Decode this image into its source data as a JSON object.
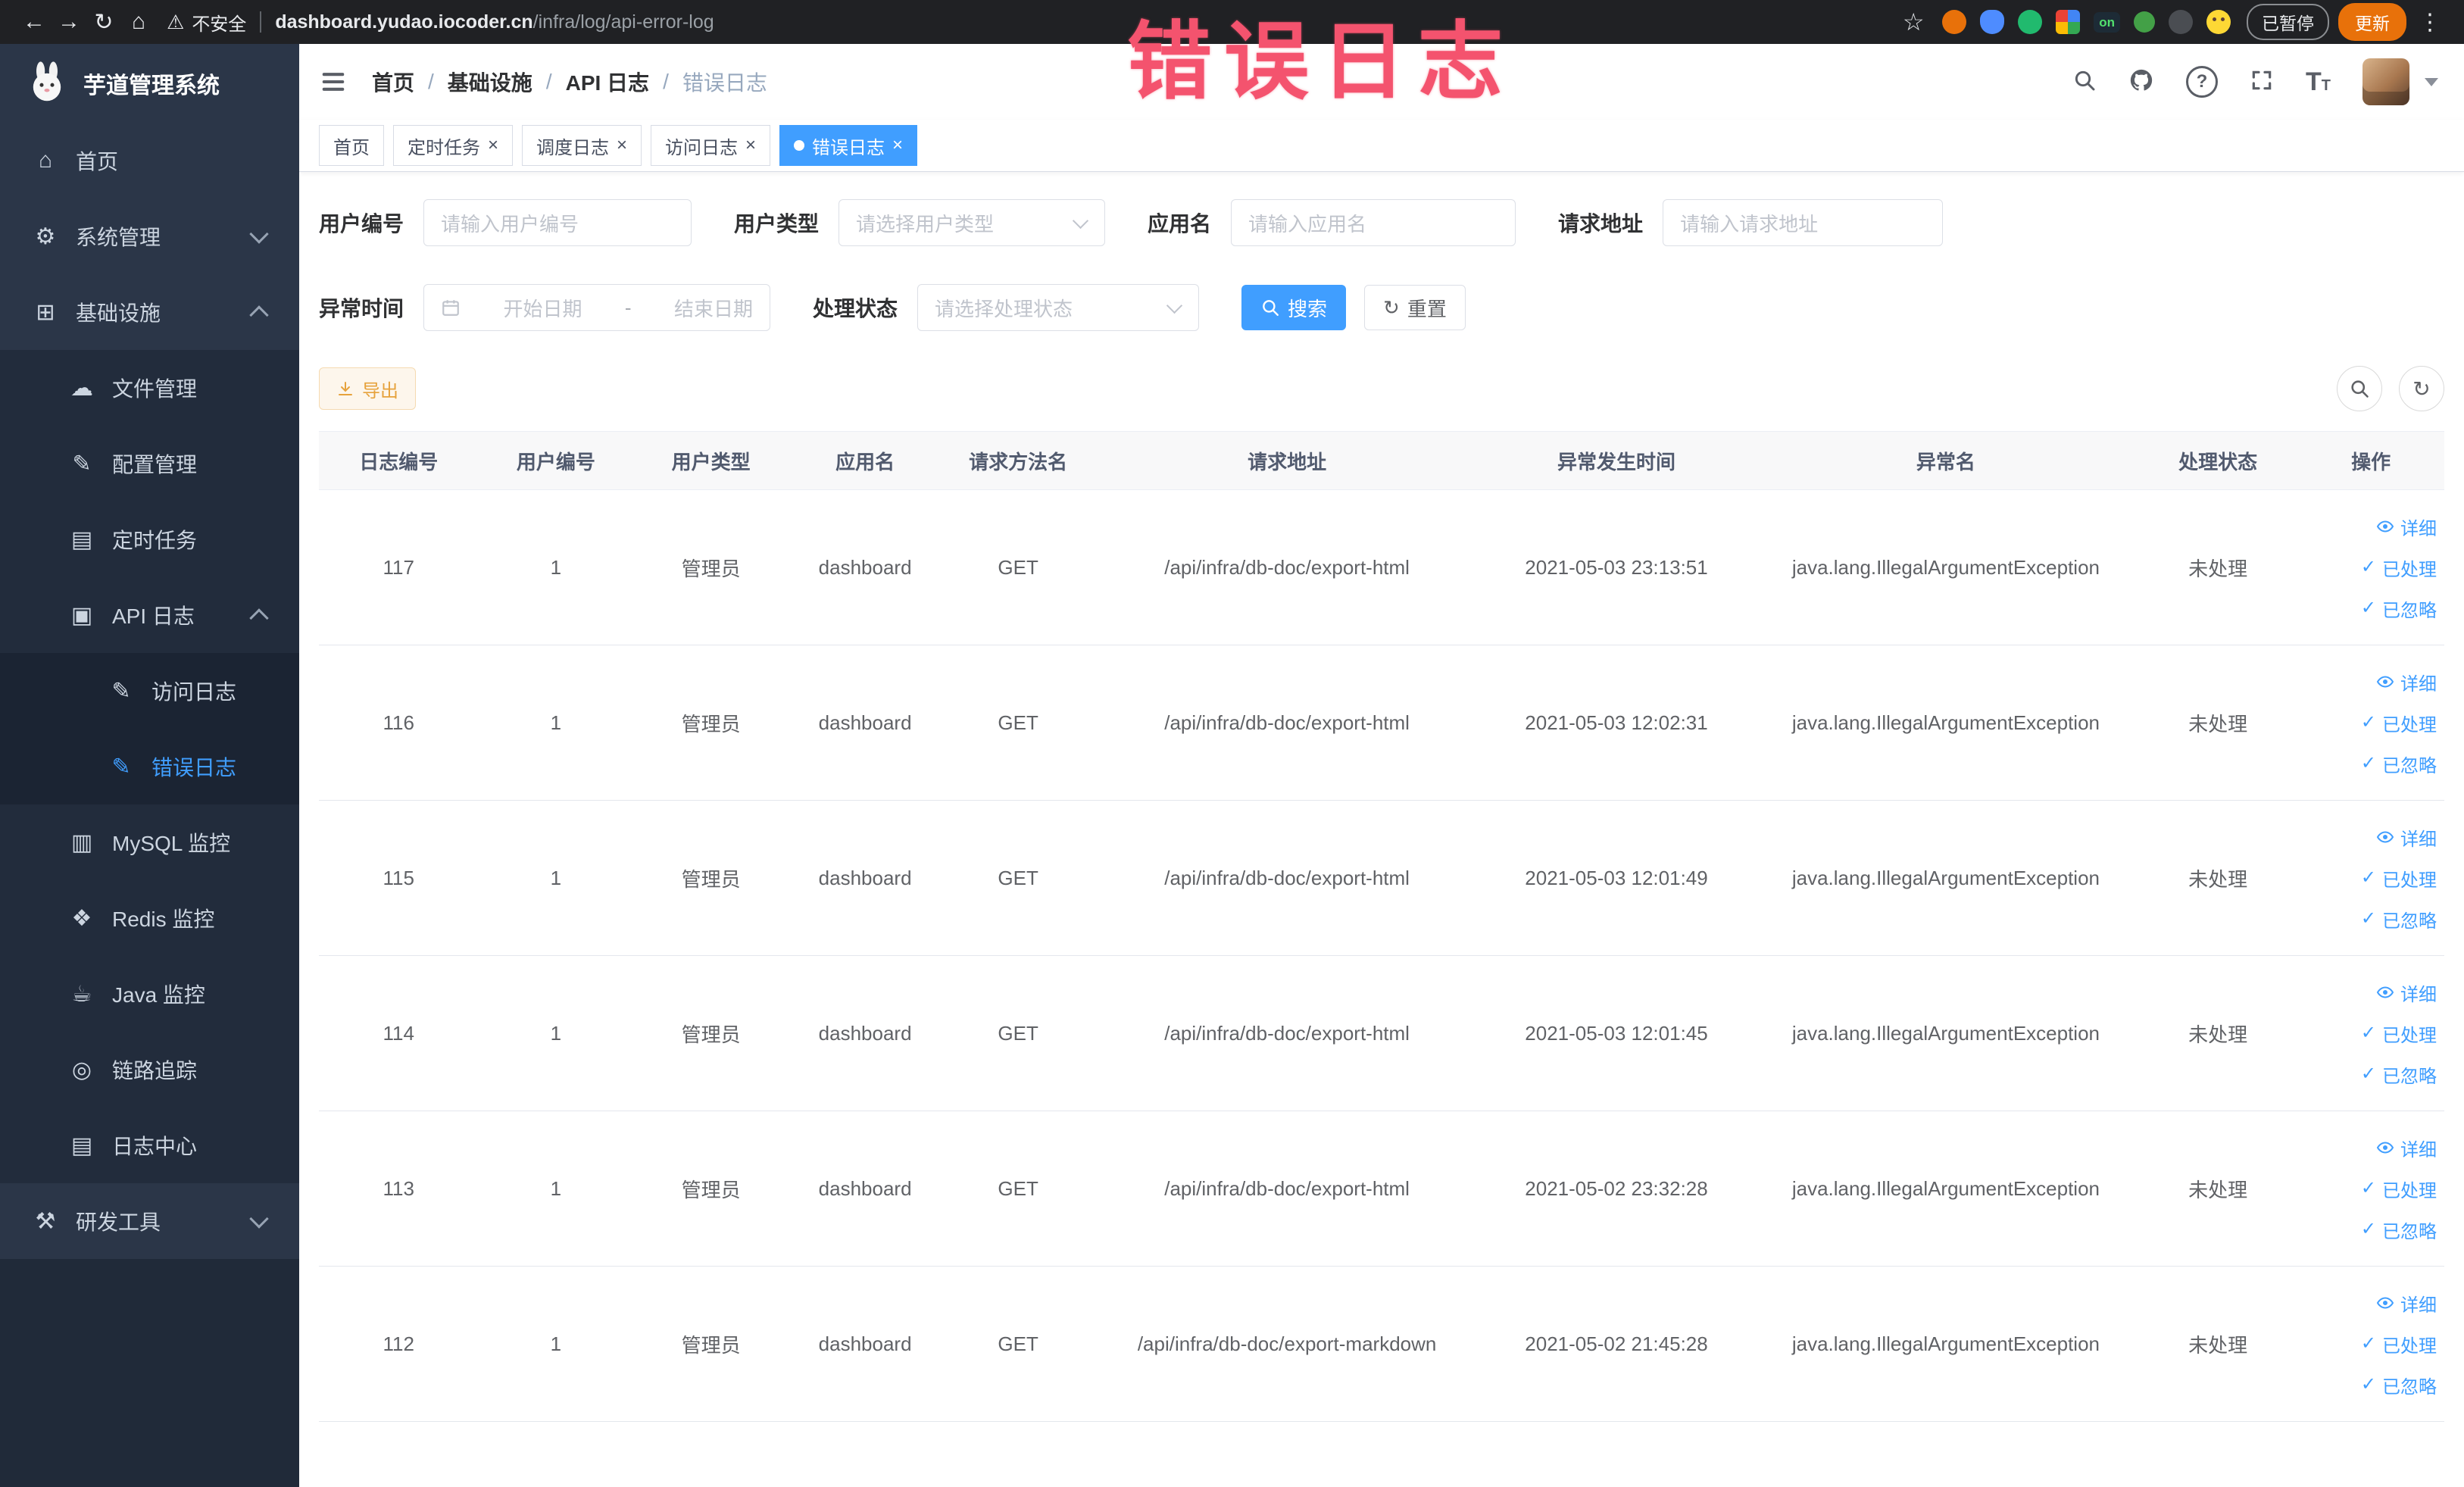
{
  "browser": {
    "security_label": "不安全",
    "url_host": "dashboard.yudao.iocoder.cn",
    "url_path": "/infra/log/api-error-log",
    "ext_on_label": "on",
    "paused_label": "已暂停",
    "update_label": "更新"
  },
  "annotation": {
    "text": "错误日志",
    "color": "#f4536e"
  },
  "icons": {
    "back": "←",
    "forward": "→",
    "reload": "↻",
    "home": "⌂",
    "warning": "⚠",
    "star": "☆",
    "menu_dots": "⋮",
    "close": "×",
    "check": "✓",
    "refresh": "↻",
    "help": "?",
    "font_size": "T",
    "menu_home": "⌂",
    "menu_system": "⚙",
    "menu_infra": "⊞",
    "menu_file": "☁",
    "menu_config": "✎",
    "menu_job": "▤",
    "menu_apilog": "▣",
    "menu_accesslog": "✎",
    "menu_errorlog": "✎",
    "menu_mysql": "▥",
    "menu_redis": "❖",
    "menu_java": "☕",
    "menu_trace": "◎",
    "menu_logcenter": "▤",
    "menu_tools": "⚒"
  },
  "sidebar": {
    "logo_title": "芋道管理系统",
    "menu": [
      {
        "label": "首页"
      },
      {
        "label": "系统管理"
      },
      {
        "label": "基础设施"
      },
      {
        "label": "文件管理"
      },
      {
        "label": "配置管理"
      },
      {
        "label": "定时任务"
      },
      {
        "label": "API 日志"
      },
      {
        "label": "访问日志"
      },
      {
        "label": "错误日志"
      },
      {
        "label": "MySQL 监控"
      },
      {
        "label": "Redis 监控"
      },
      {
        "label": "Java 监控"
      },
      {
        "label": "链路追踪"
      },
      {
        "label": "日志中心"
      },
      {
        "label": "研发工具"
      }
    ]
  },
  "breadcrumb": {
    "separator": "/",
    "items": [
      "首页",
      "基础设施",
      "API 日志"
    ],
    "current": "错误日志"
  },
  "tabs": [
    {
      "label": "首页"
    },
    {
      "label": "定时任务"
    },
    {
      "label": "调度日志"
    },
    {
      "label": "访问日志"
    },
    {
      "label": "错误日志"
    }
  ],
  "filters": {
    "user_id_label": "用户编号",
    "user_id_placeholder": "请输入用户编号",
    "user_type_label": "用户类型",
    "user_type_placeholder": "请选择用户类型",
    "app_name_label": "应用名",
    "app_name_placeholder": "请输入应用名",
    "request_url_label": "请求地址",
    "request_url_placeholder": "请输入请求地址",
    "time_label": "异常时间",
    "time_start_placeholder": "开始日期",
    "time_separator": "-",
    "time_end_placeholder": "结束日期",
    "status_label": "处理状态",
    "status_placeholder": "请选择处理状态",
    "search_label": "搜索",
    "reset_label": "重置"
  },
  "toolbar": {
    "export_label": "导出"
  },
  "table": {
    "columns": [
      "日志编号",
      "用户编号",
      "用户类型",
      "应用名",
      "请求方法名",
      "请求地址",
      "异常发生时间",
      "异常名",
      "处理状态",
      "操作"
    ],
    "row_actions": [
      "详细",
      "已处理",
      "已忽略"
    ],
    "rows": [
      {
        "id": "117",
        "user_id": "1",
        "user_type": "管理员",
        "app": "dashboard",
        "method": "GET",
        "url": "/api/infra/db-doc/export-html",
        "time": "2021-05-03 23:13:51",
        "exception": "java.lang.IllegalArgumentException",
        "status": "未处理"
      },
      {
        "id": "116",
        "user_id": "1",
        "user_type": "管理员",
        "app": "dashboard",
        "method": "GET",
        "url": "/api/infra/db-doc/export-html",
        "time": "2021-05-03 12:02:31",
        "exception": "java.lang.IllegalArgumentException",
        "status": "未处理"
      },
      {
        "id": "115",
        "user_id": "1",
        "user_type": "管理员",
        "app": "dashboard",
        "method": "GET",
        "url": "/api/infra/db-doc/export-html",
        "time": "2021-05-03 12:01:49",
        "exception": "java.lang.IllegalArgumentException",
        "status": "未处理"
      },
      {
        "id": "114",
        "user_id": "1",
        "user_type": "管理员",
        "app": "dashboard",
        "method": "GET",
        "url": "/api/infra/db-doc/export-html",
        "time": "2021-05-03 12:01:45",
        "exception": "java.lang.IllegalArgumentException",
        "status": "未处理"
      },
      {
        "id": "113",
        "user_id": "1",
        "user_type": "管理员",
        "app": "dashboard",
        "method": "GET",
        "url": "/api/infra/db-doc/export-html",
        "time": "2021-05-02 23:32:28",
        "exception": "java.lang.IllegalArgumentException",
        "status": "未处理"
      },
      {
        "id": "112",
        "user_id": "1",
        "user_type": "管理员",
        "app": "dashboard",
        "method": "GET",
        "url": "/api/infra/db-doc/export-markdown",
        "time": "2021-05-02 21:45:28",
        "exception": "java.lang.IllegalArgumentException",
        "status": "未处理"
      }
    ]
  }
}
